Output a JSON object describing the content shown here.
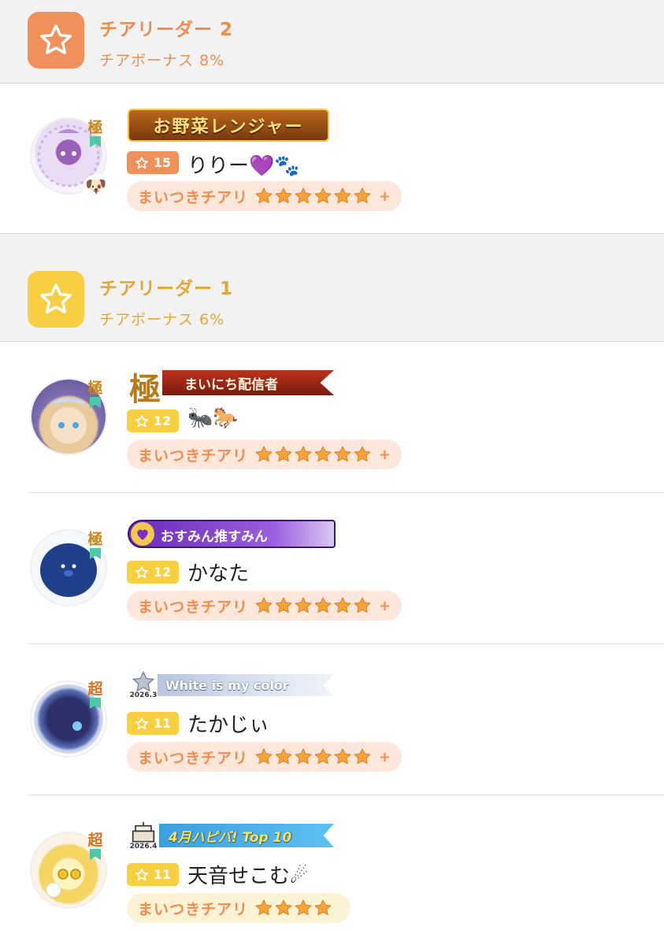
{
  "sections": [
    {
      "title": "チアリーダー 2",
      "bonus": "チアボーナス 8%",
      "color": "#f0915b",
      "members": [
        {
          "banner": "お野菜レンジャー",
          "grade": "極",
          "level": "15",
          "name": "りりー💜🐾",
          "badge_emoji": "🐶",
          "cheer_label": "まいつきチアリ",
          "stars": 6,
          "plus": "+"
        }
      ]
    },
    {
      "title": "チアリーダー 1",
      "bonus": "チアボーナス 6%",
      "color": "#f8cf42",
      "members": [
        {
          "banner_big": "極",
          "banner": "まいにち配信者",
          "grade": "極",
          "level": "12",
          "name": "🐜🐎",
          "cheer_label": "まいつきチアリ",
          "stars": 6,
          "plus": "+"
        },
        {
          "banner": "おすみん推すみん",
          "grade": "極",
          "level": "12",
          "name": "かなた",
          "cheer_label": "まいつきチアリ",
          "stars": 6,
          "plus": "+"
        },
        {
          "banner": "White is my color",
          "banner_date": "2026.3",
          "grade": "超",
          "level": "11",
          "name": "たかじぃ",
          "cheer_label": "まいつきチアリ",
          "stars": 6,
          "plus": "+"
        },
        {
          "banner": "4月ハピバ! Top 10",
          "banner_date": "2026.4",
          "grade": "超",
          "level": "11",
          "name": "天音せこむ☄",
          "cheer_label": "まいつきチアリ",
          "stars": 4,
          "plus": ""
        }
      ]
    }
  ],
  "icons": {
    "tier": "star-outline-icon",
    "level": "star-outline-icon",
    "cheer_star": "star-filled-icon"
  }
}
